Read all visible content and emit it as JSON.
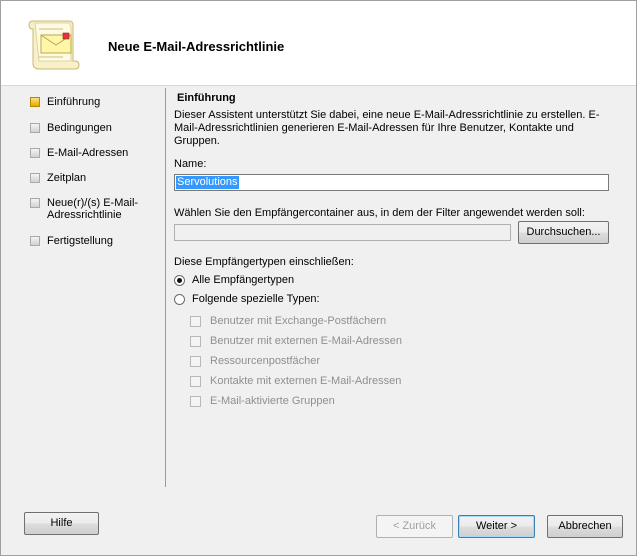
{
  "window": {
    "title": "Neue E-Mail-Adressrichtlinie"
  },
  "nav": {
    "items": [
      {
        "label": "Einführung",
        "active": true
      },
      {
        "label": "Bedingungen",
        "active": false
      },
      {
        "label": "E-Mail-Adressen",
        "active": false
      },
      {
        "label": "Zeitplan",
        "active": false
      },
      {
        "label": "Neue(r)/(s) E-Mail-Adressrichtlinie",
        "active": false
      },
      {
        "label": "Fertigstellung",
        "active": false
      }
    ]
  },
  "intro": {
    "heading": "Einführung",
    "description": "Dieser Assistent unterstützt Sie dabei, eine neue E-Mail-Adressrichtlinie zu erstellen. E-Mail-Adressrichtlinien generieren E-Mail-Adressen für Ihre Benutzer, Kontakte und Gruppen."
  },
  "form": {
    "name_label": "Name:",
    "name_value": "Servolutions",
    "container_label": "Wählen Sie den Empfängercontainer aus, in dem der Filter angewendet werden soll:",
    "container_value": "",
    "browse_label": "Durchsuchen...",
    "recipient_types_label": "Diese Empfängertypen einschließen:",
    "radio_all": {
      "label": "Alle Empfängertypen",
      "checked": true
    },
    "radio_specific": {
      "label": "Folgende spezielle Typen:",
      "checked": false
    },
    "specific_types": [
      {
        "label": "Benutzer mit Exchange-Postfächern",
        "checked": false
      },
      {
        "label": "Benutzer mit externen E-Mail-Adressen",
        "checked": false
      },
      {
        "label": "Ressourcenpostfächer",
        "checked": false
      },
      {
        "label": "Kontakte mit externen E-Mail-Adressen",
        "checked": false
      },
      {
        "label": "E-Mail-aktivierte Gruppen",
        "checked": false
      }
    ]
  },
  "footer": {
    "help": "Hilfe",
    "back": "< Zurück",
    "next": "Weiter >",
    "cancel": "Abbrechen"
  },
  "colors": {
    "selection": "#3399ff",
    "active_step": "#e9a800",
    "default_button_border": "#3c7fb1"
  }
}
